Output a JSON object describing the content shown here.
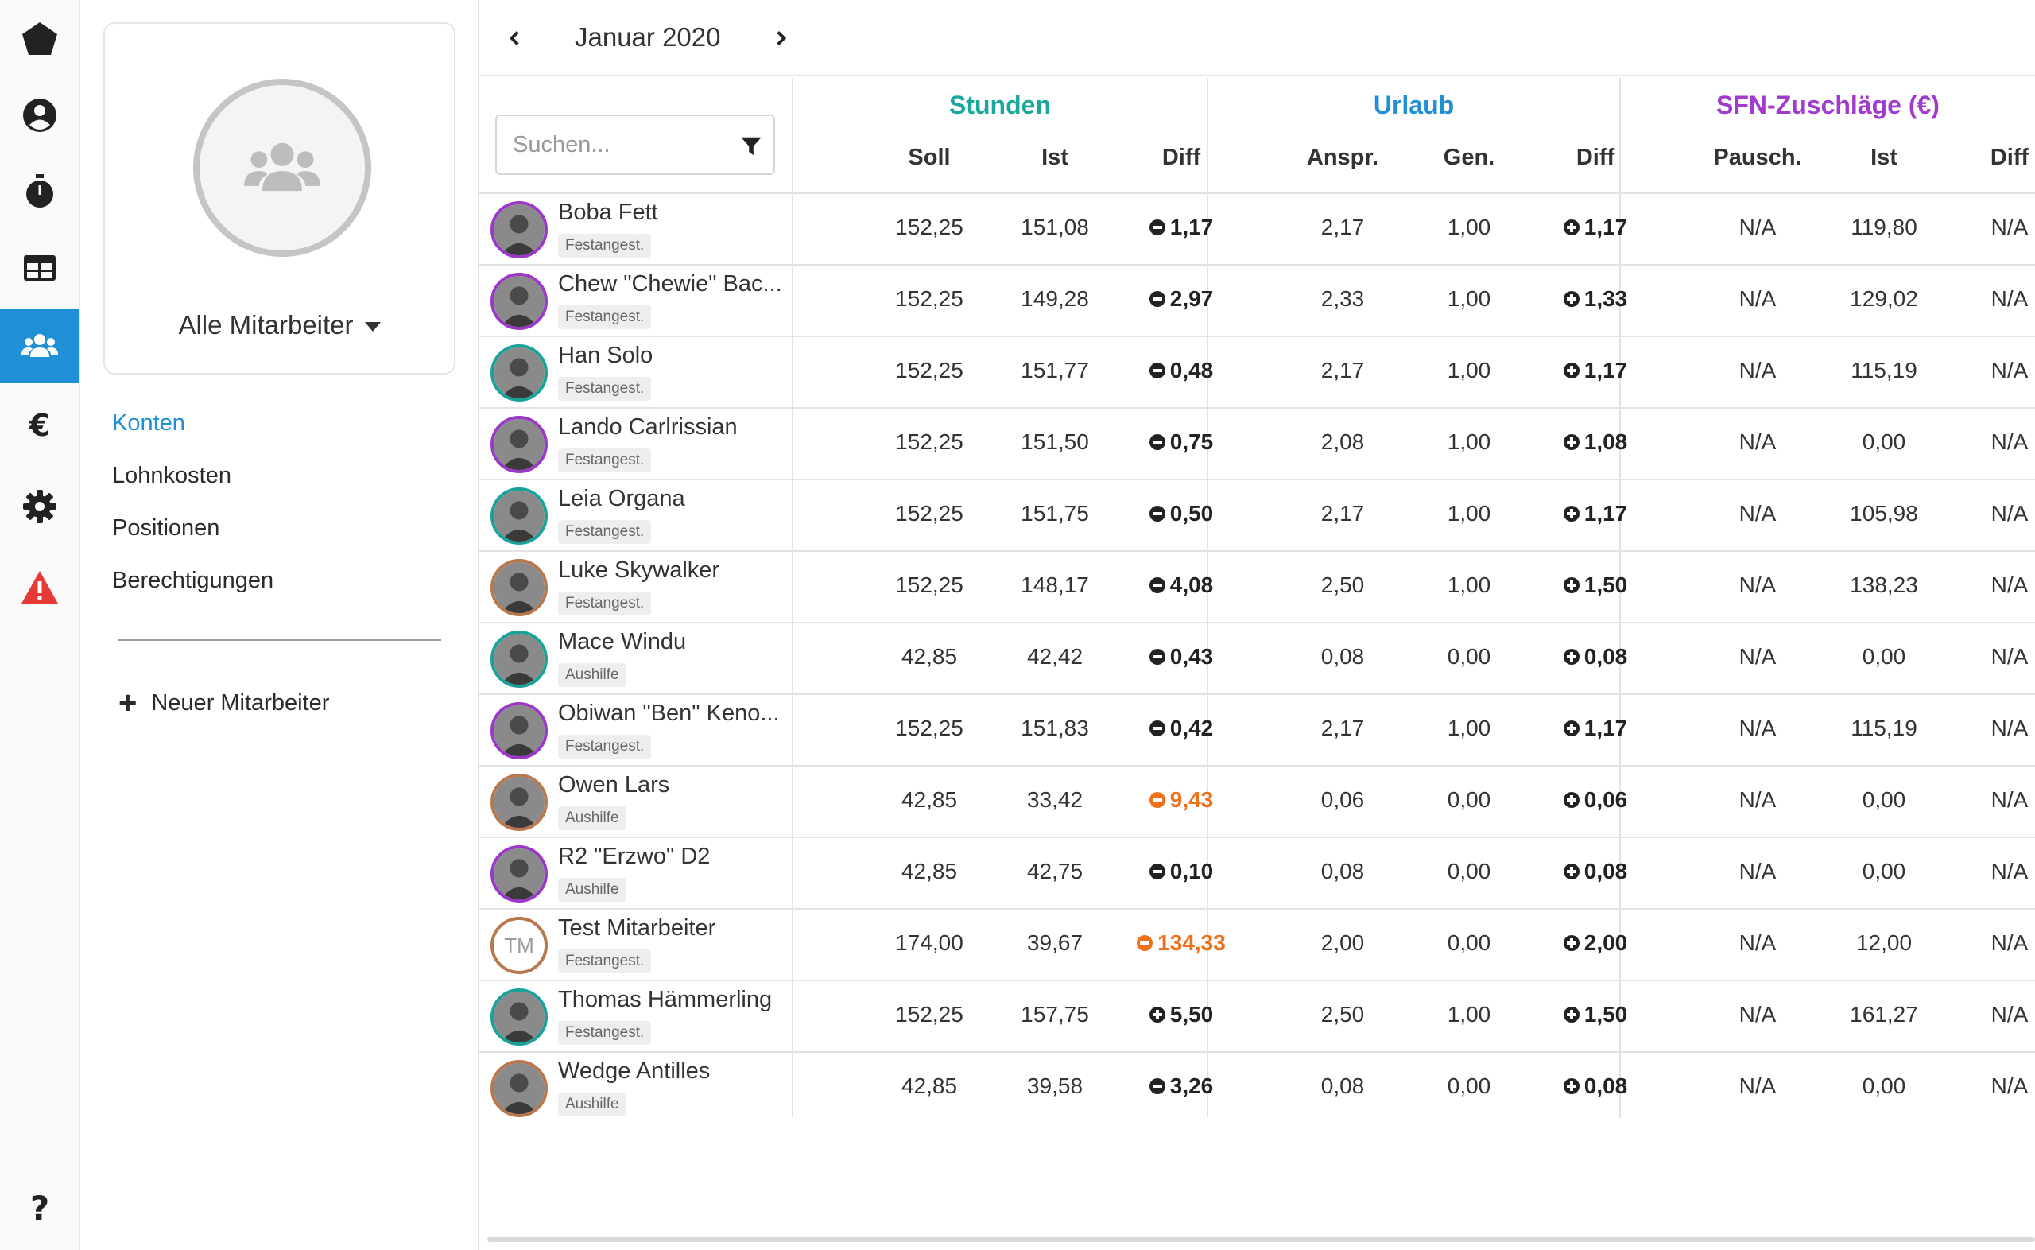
{
  "colors": {
    "accent": "#1f8fd6",
    "stunden": "#1aa89d",
    "urlaub": "#1f8fd6",
    "sfn": "#a13bcf",
    "warn": "#ef7019"
  },
  "rail": {
    "items": [
      "pentagon-logo-icon",
      "user-circle-icon",
      "stopwatch-icon",
      "table-icon",
      "team-icon",
      "euro-icon",
      "gear-icon",
      "warning-icon",
      "help-icon"
    ],
    "active": "team-icon"
  },
  "team": {
    "select_label": "Alle Mitarbeiter"
  },
  "subnav": {
    "konten": "Konten",
    "lohnkosten": "Lohnkosten",
    "positionen": "Positionen",
    "berechtigungen": "Berechtigungen"
  },
  "new_employee_label": "Neuer Mitarbeiter",
  "month": {
    "label": "Januar 2020"
  },
  "search": {
    "placeholder": "Suchen..."
  },
  "groups": {
    "stunden": "Stunden",
    "urlaub": "Urlaub",
    "sfn": "SFN-Zuschläge (€)"
  },
  "columns": {
    "soll": "Soll",
    "ist": "Ist",
    "diff": "Diff",
    "anspr": "Anspr.",
    "gen": "Gen.",
    "udiff": "Diff",
    "pausch": "Pausch.",
    "sist": "Ist",
    "sdiff": "Diff"
  },
  "rows": [
    {
      "name": "Boba Fett",
      "type": "Festangest.",
      "ring": "purple",
      "initials": "",
      "soll": "152,25",
      "ist": "151,08",
      "diff": "1,17",
      "diff_sign": "minus",
      "diff_warn": false,
      "anspr": "2,17",
      "gen": "1,00",
      "udiff": "1,17",
      "pausch": "N/A",
      "sist": "119,80",
      "sdiff": "N/A"
    },
    {
      "name": "Chew \"Chewie\" Bac...",
      "type": "Festangest.",
      "ring": "purple",
      "initials": "",
      "soll": "152,25",
      "ist": "149,28",
      "diff": "2,97",
      "diff_sign": "minus",
      "diff_warn": false,
      "anspr": "2,33",
      "gen": "1,00",
      "udiff": "1,33",
      "pausch": "N/A",
      "sist": "129,02",
      "sdiff": "N/A"
    },
    {
      "name": "Han Solo",
      "type": "Festangest.",
      "ring": "teal",
      "initials": "",
      "soll": "152,25",
      "ist": "151,77",
      "diff": "0,48",
      "diff_sign": "minus",
      "diff_warn": false,
      "anspr": "2,17",
      "gen": "1,00",
      "udiff": "1,17",
      "pausch": "N/A",
      "sist": "115,19",
      "sdiff": "N/A"
    },
    {
      "name": "Lando Carlrissian",
      "type": "Festangest.",
      "ring": "purple",
      "initials": "",
      "soll": "152,25",
      "ist": "151,50",
      "diff": "0,75",
      "diff_sign": "minus",
      "diff_warn": false,
      "anspr": "2,08",
      "gen": "1,00",
      "udiff": "1,08",
      "pausch": "N/A",
      "sist": "0,00",
      "sdiff": "N/A"
    },
    {
      "name": "Leia Organa",
      "type": "Festangest.",
      "ring": "teal",
      "initials": "",
      "soll": "152,25",
      "ist": "151,75",
      "diff": "0,50",
      "diff_sign": "minus",
      "diff_warn": false,
      "anspr": "2,17",
      "gen": "1,00",
      "udiff": "1,17",
      "pausch": "N/A",
      "sist": "105,98",
      "sdiff": "N/A"
    },
    {
      "name": "Luke Skywalker",
      "type": "Festangest.",
      "ring": "brown",
      "initials": "",
      "soll": "152,25",
      "ist": "148,17",
      "diff": "4,08",
      "diff_sign": "minus",
      "diff_warn": false,
      "anspr": "2,50",
      "gen": "1,00",
      "udiff": "1,50",
      "pausch": "N/A",
      "sist": "138,23",
      "sdiff": "N/A"
    },
    {
      "name": "Mace Windu",
      "type": "Aushilfe",
      "ring": "teal",
      "initials": "",
      "soll": "42,85",
      "ist": "42,42",
      "diff": "0,43",
      "diff_sign": "minus",
      "diff_warn": false,
      "anspr": "0,08",
      "gen": "0,00",
      "udiff": "0,08",
      "pausch": "N/A",
      "sist": "0,00",
      "sdiff": "N/A"
    },
    {
      "name": "Obiwan \"Ben\" Keno...",
      "type": "Festangest.",
      "ring": "purple",
      "initials": "",
      "soll": "152,25",
      "ist": "151,83",
      "diff": "0,42",
      "diff_sign": "minus",
      "diff_warn": false,
      "anspr": "2,17",
      "gen": "1,00",
      "udiff": "1,17",
      "pausch": "N/A",
      "sist": "115,19",
      "sdiff": "N/A"
    },
    {
      "name": "Owen Lars",
      "type": "Aushilfe",
      "ring": "brown",
      "initials": "",
      "soll": "42,85",
      "ist": "33,42",
      "diff": "9,43",
      "diff_sign": "minus",
      "diff_warn": true,
      "anspr": "0,06",
      "gen": "0,00",
      "udiff": "0,06",
      "pausch": "N/A",
      "sist": "0,00",
      "sdiff": "N/A"
    },
    {
      "name": "R2 \"Erzwo\" D2",
      "type": "Aushilfe",
      "ring": "purple",
      "initials": "",
      "soll": "42,85",
      "ist": "42,75",
      "diff": "0,10",
      "diff_sign": "minus",
      "diff_warn": false,
      "anspr": "0,08",
      "gen": "0,00",
      "udiff": "0,08",
      "pausch": "N/A",
      "sist": "0,00",
      "sdiff": "N/A"
    },
    {
      "name": "Test Mitarbeiter",
      "type": "Festangest.",
      "ring": "brown",
      "initials": "TM",
      "soll": "174,00",
      "ist": "39,67",
      "diff": "134,33",
      "diff_sign": "minus",
      "diff_warn": true,
      "anspr": "2,00",
      "gen": "0,00",
      "udiff": "2,00",
      "pausch": "N/A",
      "sist": "12,00",
      "sdiff": "N/A"
    },
    {
      "name": "Thomas Hämmerling",
      "type": "Festangest.",
      "ring": "teal",
      "initials": "",
      "soll": "152,25",
      "ist": "157,75",
      "diff": "5,50",
      "diff_sign": "plus",
      "diff_warn": false,
      "anspr": "2,50",
      "gen": "1,00",
      "udiff": "1,50",
      "pausch": "N/A",
      "sist": "161,27",
      "sdiff": "N/A"
    },
    {
      "name": "Wedge Antilles",
      "type": "Aushilfe",
      "ring": "brown",
      "initials": "",
      "soll": "42,85",
      "ist": "39,58",
      "diff": "3,26",
      "diff_sign": "minus",
      "diff_warn": false,
      "anspr": "0,08",
      "gen": "0,00",
      "udiff": "0,08",
      "pausch": "N/A",
      "sist": "0,00",
      "sdiff": "N/A"
    }
  ]
}
